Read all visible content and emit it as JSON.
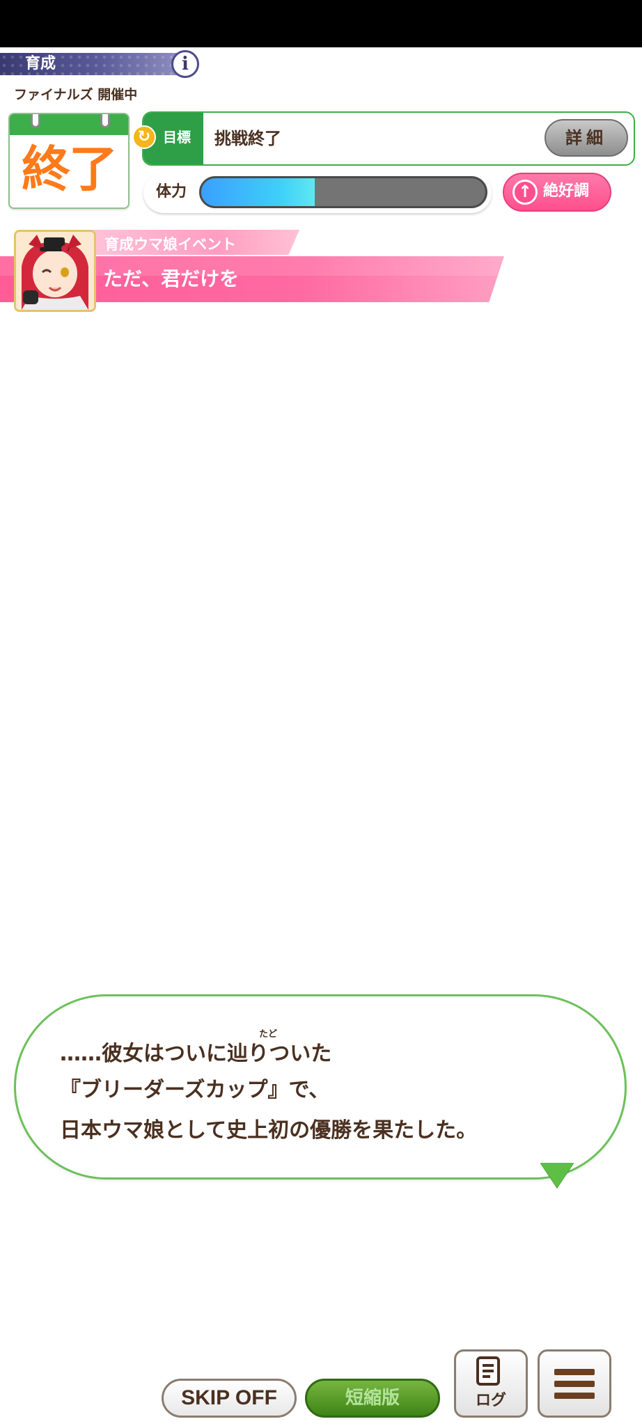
{
  "header": {
    "title": "育成",
    "info_icon": "info-icon"
  },
  "status": {
    "finals_label": "ファイナルズ 開催中",
    "calendar_text": "終了",
    "goal_label": "目標",
    "goal_text": "挑戦終了",
    "detail_button": "詳細",
    "stamina_label": "体力",
    "stamina_level": 0.4,
    "mood_label": "絶好調",
    "mood_icon": "up-arrow-icon"
  },
  "event": {
    "category": "育成ウマ娘イベント",
    "title": "ただ、君だけを"
  },
  "dialogue": {
    "ruby": "たど",
    "lines": [
      "……彼女はついに辿りついた",
      "『ブリーダーズカップ』で、",
      "日本ウマ娘として史上初の優勝を果たした。"
    ]
  },
  "controls": {
    "skip_button": "SKIP OFF",
    "short_button": "短縮版",
    "log_button": "ログ",
    "menu_icon": "menu-icon"
  },
  "colors": {
    "accent_green": "#3cae4a",
    "accent_pink": "#ff5c98",
    "text_brown": "#4a3020",
    "calendar_orange": "#ff7a1a"
  }
}
